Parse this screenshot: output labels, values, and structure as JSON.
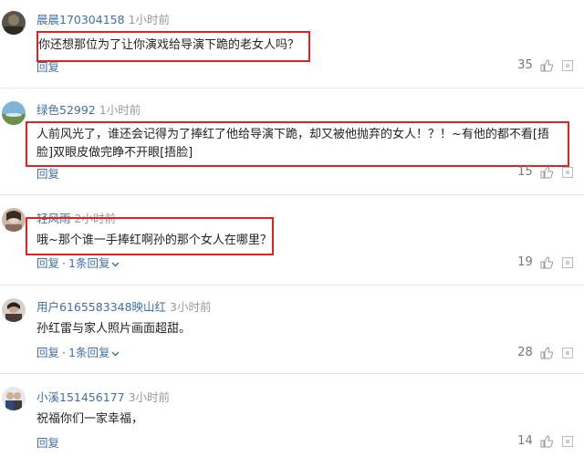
{
  "comments": [
    {
      "username": "晨晨170304158",
      "time": "1小时前",
      "text": "你还想那位为了让你演戏给导演下跪的老女人吗？",
      "reply_label": "回复",
      "likes": "35"
    },
    {
      "username": "绿色52992",
      "time": "1小时前",
      "text_line1": "人前风光了，谁还会记得为了捧红了他给导演下跪，却又被他抛弃的女人！？！~有他的都不看[捂",
      "text_line2": "脸]双眼皮做完睁不开眼[捂脸]",
      "reply_label": "回复",
      "likes": "15"
    },
    {
      "username": "轻风雨",
      "time": "2小时前",
      "text": "哦~那个谁一手捧红啊孙的那个女人在哪里？",
      "reply_label": "回复",
      "replies_label": "1条回复",
      "likes": "19"
    },
    {
      "username": "用户6165583348映山红",
      "time": "3小时前",
      "text": "孙红雷与家人照片画面超甜。",
      "reply_label": "回复",
      "replies_label": "1条回复",
      "likes": "28"
    },
    {
      "username": "小溪151456177",
      "time": "3小时前",
      "text": "祝福你们一家幸福，",
      "reply_label": "回复",
      "likes": "14"
    }
  ],
  "colors": {
    "username": "#3f6fa8",
    "highlight_border": "#e02222",
    "meta_gray": "#999999"
  },
  "icons": {
    "like": "thumbs-up-icon",
    "report": "report-icon",
    "expand": "chevron-down-icon"
  }
}
